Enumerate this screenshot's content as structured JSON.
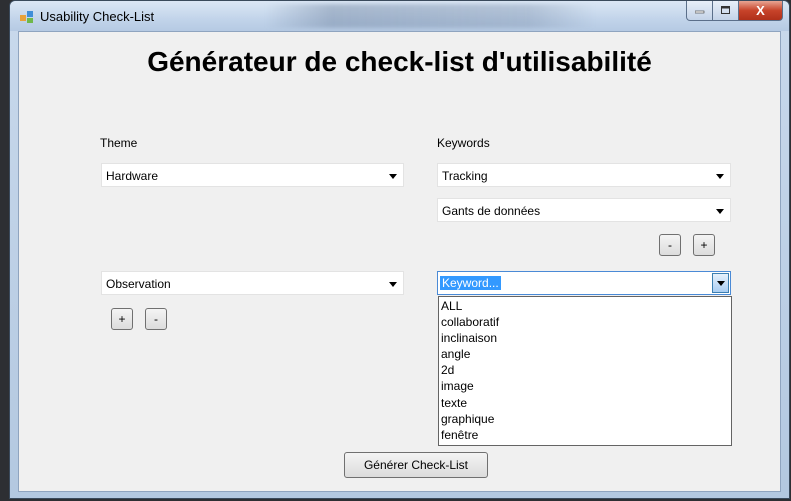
{
  "window": {
    "title": "Usability Check-List",
    "close_glyph": "X",
    "minimize_glyph": "▁",
    "maximize_glyph": "☐"
  },
  "heading": "Générateur de check-list d'utilisabilité",
  "theme": {
    "label": "Theme",
    "combo1_value": "Hardware",
    "combo2_value": "Observation",
    "plus_label": "+",
    "minus_label": "-"
  },
  "keywords": {
    "label": "Keywords",
    "combo1_value": "Tracking",
    "combo2_value": "Gants de données",
    "minus_label": "-",
    "plus_label": "+",
    "active_combo_value": "Keyword...",
    "options": [
      "ALL",
      "collaboratif",
      "inclinaison",
      "angle",
      "2d",
      "image",
      "texte",
      "graphique",
      "fenêtre"
    ]
  },
  "generate_button": "Générer Check-List",
  "icons": {
    "app": "app-icon",
    "dropdown": "chevron-down-icon"
  }
}
